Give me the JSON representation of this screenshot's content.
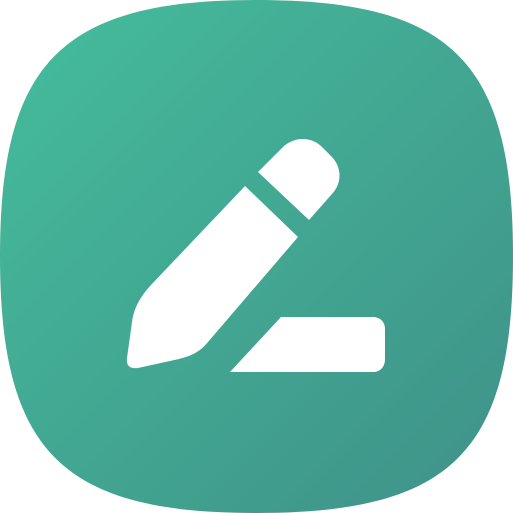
{
  "app_icon": {
    "icon": "edit-pencil-icon",
    "colors": {
      "gradient_start": "#45BD9C",
      "gradient_end": "#3F9188",
      "glyph": "#FFFFFF",
      "page_background": "#FFFFFF"
    }
  }
}
